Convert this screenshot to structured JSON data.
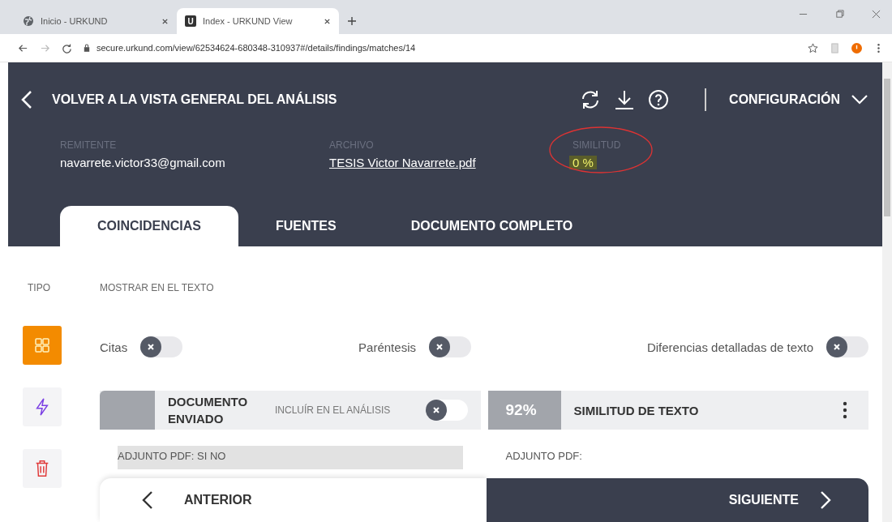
{
  "browser": {
    "tabs": [
      {
        "title": "Inicio - URKUND",
        "kind": "globe",
        "selected": false
      },
      {
        "title": "Index - URKUND View",
        "kind": "logo",
        "logo_letter": "U",
        "selected": true
      }
    ],
    "url": "secure.urkund.com/view/62534624-680348-310937#/details/findings/matches/14"
  },
  "header": {
    "back_label": "VOLVER A LA VISTA GENERAL DEL ANÁLISIS",
    "settings_label": "CONFIGURACIÓN",
    "meta": [
      {
        "label": "REMITENTE",
        "value": "navarrete.victor33@gmail.com",
        "kind": "text"
      },
      {
        "label": "ARCHIVO",
        "value": "TESIS Victor Navarrete.pdf",
        "kind": "link"
      },
      {
        "label": "SIMILITUD",
        "value": "0 %",
        "kind": "highlight"
      }
    ]
  },
  "tabs": [
    {
      "label": "COINCIDENCIAS",
      "selected": true
    },
    {
      "label": "FUENTES",
      "selected": false
    },
    {
      "label": "DOCUMENTO COMPLETO",
      "selected": false
    }
  ],
  "filters": {
    "type_label": "TIPO",
    "show_label": "MOSTRAR EN EL TEXTO",
    "toggles": [
      {
        "label": "Citas",
        "on": false
      },
      {
        "label": "Paréntesis",
        "on": false
      },
      {
        "label": "Diferencias detalladas de texto",
        "on": false
      }
    ]
  },
  "type_buttons": [
    {
      "kind": "grid",
      "selected": true
    },
    {
      "kind": "bolt",
      "selected": false
    },
    {
      "kind": "trash",
      "selected": false
    }
  ],
  "left_panel": {
    "title": "DOCUMENTO ENVIADO",
    "include_label": "INCLUÍR EN EL ANÁLISIS",
    "include_on": false,
    "text": "ADJUNTO PDF: SI NO"
  },
  "right_panel": {
    "percent": "92%",
    "title": "SIMILITUD DE TEXTO",
    "text": "ADJUNTO PDF:"
  },
  "nav": {
    "prev": "ANTERIOR",
    "next": "SIGUIENTE"
  }
}
